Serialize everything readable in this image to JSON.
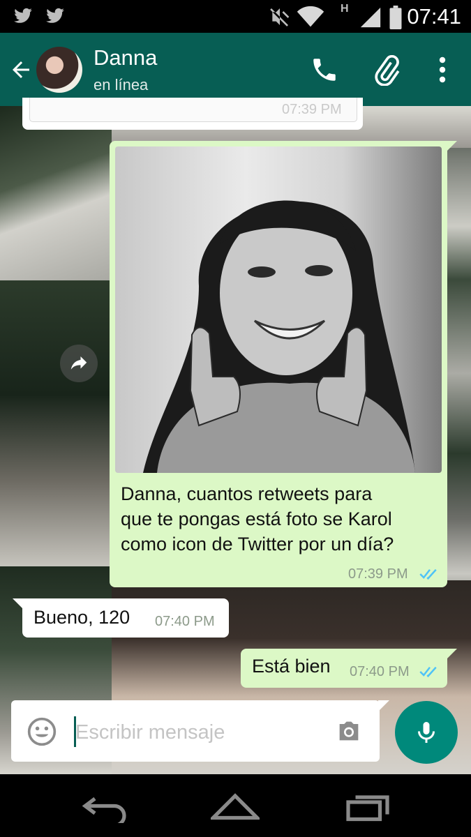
{
  "status_bar": {
    "time": "07:41",
    "network": "H",
    "icons": [
      "twitter-icon",
      "twitter-icon",
      "mute-icon",
      "wifi-icon",
      "signal-icon",
      "battery-icon"
    ]
  },
  "app_bar": {
    "contact_name": "Danna",
    "contact_status": "en línea",
    "icons": [
      "back-arrow-icon",
      "phone-icon",
      "paperclip-icon",
      "more-vert-icon"
    ],
    "color": "#075e54"
  },
  "messages": [
    {
      "direction": "incoming",
      "type": "embedded-tweet",
      "time": "07:39 PM"
    },
    {
      "direction": "outgoing",
      "type": "image",
      "caption_lines": [
        "Danna, cuantos retweets para",
        "que te pongas está foto se Karol",
        "como icon de Twitter por un día?"
      ],
      "time": "07:39 PM",
      "status": "read"
    },
    {
      "direction": "incoming",
      "type": "text",
      "text": "Bueno, 120",
      "time": "07:40 PM"
    },
    {
      "direction": "outgoing",
      "type": "text",
      "text": "Está bien",
      "time": "07:40 PM",
      "status": "read"
    }
  ],
  "composer": {
    "placeholder": "Escribir mensaje",
    "icons": [
      "emoji-icon",
      "camera-icon",
      "microphone-icon"
    ]
  },
  "nav_bar": {
    "icons": [
      "back-icon",
      "home-icon",
      "recents-icon"
    ]
  },
  "colors": {
    "outgoing_bubble": "#dcf8c6",
    "incoming_bubble": "#ffffff",
    "read_check": "#4fc3f7",
    "fab": "#00897b"
  }
}
